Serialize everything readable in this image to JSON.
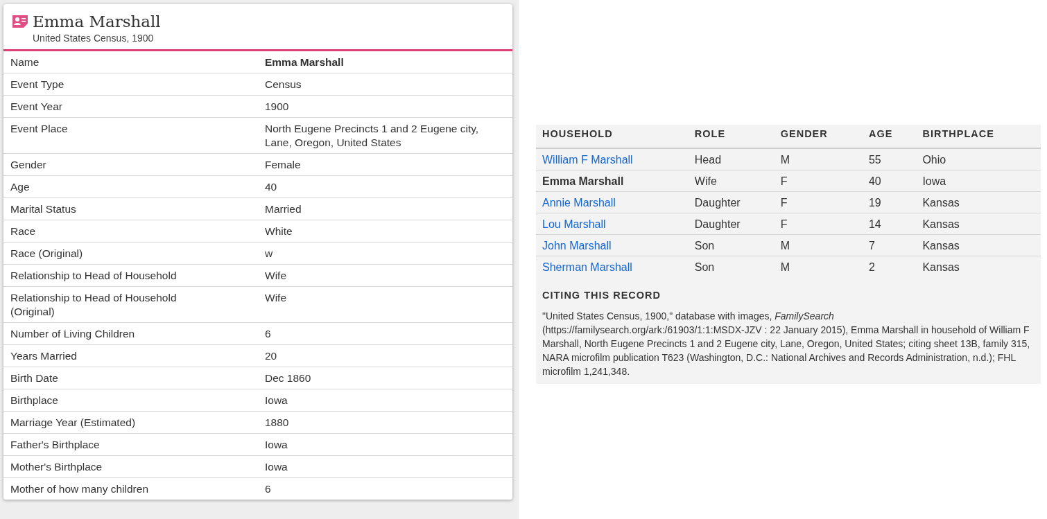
{
  "record": {
    "name": "Emma Marshall",
    "collection": "United States Census, 1900"
  },
  "fields": [
    {
      "label": "Name",
      "value": "Emma Marshall",
      "emphasis": true
    },
    {
      "label": "Event Type",
      "value": "Census",
      "emphasis": false
    },
    {
      "label": "Event Year",
      "value": "1900",
      "emphasis": false
    },
    {
      "label": "Event Place",
      "value": "North Eugene Precincts 1 and 2 Eugene city, Lane, Oregon, United States",
      "emphasis": false
    },
    {
      "label": "Gender",
      "value": "Female",
      "emphasis": false
    },
    {
      "label": "Age",
      "value": "40",
      "emphasis": false
    },
    {
      "label": "Marital Status",
      "value": "Married",
      "emphasis": false
    },
    {
      "label": "Race",
      "value": "White",
      "emphasis": false
    },
    {
      "label": "Race (Original)",
      "value": "w",
      "emphasis": false
    },
    {
      "label": "Relationship to Head of Household",
      "value": "Wife",
      "emphasis": false
    },
    {
      "label": "Relationship to Head of Household (Original)",
      "value": "Wife",
      "emphasis": false
    },
    {
      "label": "Number of Living Children",
      "value": "6",
      "emphasis": false
    },
    {
      "label": "Years Married",
      "value": "20",
      "emphasis": false
    },
    {
      "label": "Birth Date",
      "value": "Dec 1860",
      "emphasis": false
    },
    {
      "label": "Birthplace",
      "value": "Iowa",
      "emphasis": false
    },
    {
      "label": "Marriage Year (Estimated)",
      "value": "1880",
      "emphasis": false
    },
    {
      "label": "Father's Birthplace",
      "value": "Iowa",
      "emphasis": false
    },
    {
      "label": "Mother's Birthplace",
      "value": "Iowa",
      "emphasis": false
    },
    {
      "label": "Mother of how many children",
      "value": "6",
      "emphasis": false
    }
  ],
  "household": {
    "columns": [
      "HOUSEHOLD",
      "ROLE",
      "GENDER",
      "AGE",
      "BIRTHPLACE"
    ],
    "rows": [
      {
        "name": "William F Marshall",
        "kind": "link",
        "role": "Head",
        "gender": "M",
        "age": "55",
        "birthplace": "Ohio"
      },
      {
        "name": "Emma Marshall",
        "kind": "current",
        "role": "Wife",
        "gender": "F",
        "age": "40",
        "birthplace": "Iowa"
      },
      {
        "name": "Annie Marshall",
        "kind": "link",
        "role": "Daughter",
        "gender": "F",
        "age": "19",
        "birthplace": "Kansas"
      },
      {
        "name": "Lou Marshall",
        "kind": "link",
        "role": "Daughter",
        "gender": "F",
        "age": "14",
        "birthplace": "Kansas"
      },
      {
        "name": "John Marshall",
        "kind": "link",
        "role": "Son",
        "gender": "M",
        "age": "7",
        "birthplace": "Kansas"
      },
      {
        "name": "Sherman Marshall",
        "kind": "link",
        "role": "Son",
        "gender": "M",
        "age": "2",
        "birthplace": "Kansas"
      }
    ]
  },
  "citation": {
    "heading": "CITING THIS RECORD",
    "text": "\"United States Census, 1900,\" database with images, *FamilySearch* (https://familysearch.org/ark:/61903/1:1:MSDX-JZV : 22 January 2015), Emma Marshall in household of William F Marshall, North Eugene Precincts 1 and 2 Eugene city, Lane, Oregon, United States; citing sheet 13B, family 315, NARA microfilm publication T623 (Washington, D.C.: National Archives and Records Administration, n.d.); FHL microfilm 1,241,348."
  }
}
